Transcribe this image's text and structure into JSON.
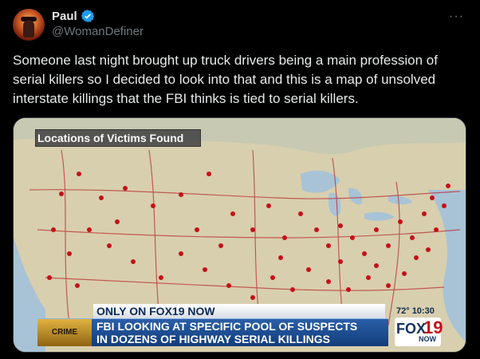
{
  "post": {
    "display_name": "Paul",
    "handle": "@WomanDefiner",
    "verified": true,
    "more_label": "···",
    "text": "Someone last night brought up truck drivers being a main profession of serial killers so I decided to look into that and this is a map of unsolved interstate killings that the FBI thinks is tied to serial killers."
  },
  "media": {
    "map_banner": "Locations of Victims Found",
    "exclusive_tag": "ONLY ON FOX19 NOW",
    "weather_time": "72° 10:30",
    "segment_tag": "CRIME WATCH",
    "headline_line1": "FBI LOOKING AT SPECIFIC POOL OF SUSPECTS",
    "headline_line2": "IN DOZENS OF HIGHWAY SERIAL KILLINGS",
    "logo_fox": "FOX",
    "logo_number": "19",
    "logo_now": "NOW"
  },
  "colors": {
    "background": "#000000",
    "text_primary": "#e7e9ea",
    "text_secondary": "#71767b",
    "verified_blue": "#1d9bf0",
    "victim_dot": "#c4121a",
    "highway": "#b8272c"
  },
  "icons": {
    "verified": "verified-badge-icon",
    "more": "more-options-icon"
  }
}
